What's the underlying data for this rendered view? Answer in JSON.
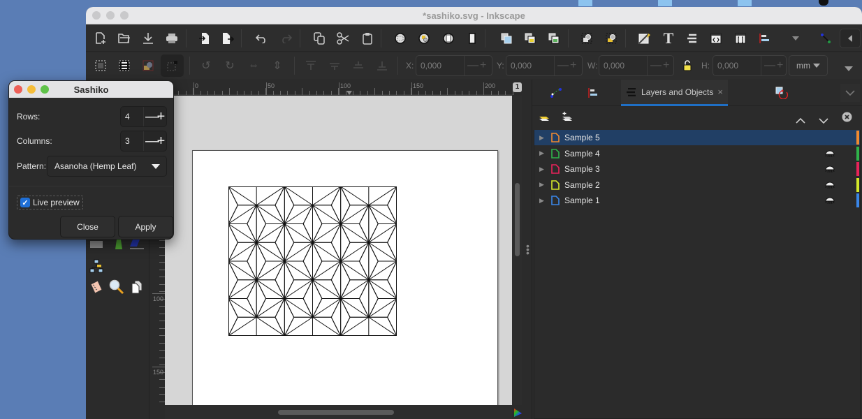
{
  "window": {
    "title": "*sashiko.svg - Inkscape"
  },
  "toolbar1": {
    "buttons": [
      {
        "name": "new-document",
        "icon": "new-document-icon"
      },
      {
        "name": "open",
        "icon": "folder-open-icon"
      },
      {
        "name": "save",
        "icon": "download-icon"
      },
      {
        "name": "print",
        "icon": "printer-icon"
      },
      {
        "name": "import",
        "icon": "import-icon"
      },
      {
        "name": "export",
        "icon": "export-icon"
      },
      {
        "name": "undo",
        "icon": "undo-icon"
      },
      {
        "name": "redo",
        "icon": "redo-icon"
      },
      {
        "name": "copy",
        "icon": "copy-icon"
      },
      {
        "name": "cut",
        "icon": "scissors-icon"
      },
      {
        "name": "paste",
        "icon": "clipboard-icon"
      },
      {
        "name": "zoom-selection",
        "icon": "zoom-selection-icon"
      },
      {
        "name": "zoom-drawing",
        "icon": "zoom-drawing-icon"
      },
      {
        "name": "zoom-page",
        "icon": "zoom-page-icon"
      },
      {
        "name": "zoom-page-width",
        "icon": "zoom-page-width-icon"
      },
      {
        "name": "duplicate",
        "icon": "duplicate-icon"
      },
      {
        "name": "clone",
        "icon": "clone-icon"
      },
      {
        "name": "unlink-clone",
        "icon": "unlink-clone-icon"
      },
      {
        "name": "group",
        "icon": "group-icon"
      },
      {
        "name": "ungroup",
        "icon": "ungroup-icon"
      },
      {
        "name": "fill-stroke",
        "icon": "fill-stroke-icon"
      },
      {
        "name": "text-font",
        "icon": "text-icon"
      },
      {
        "name": "layers",
        "icon": "layers-icon"
      },
      {
        "name": "xml-editor",
        "icon": "xml-editor-icon"
      },
      {
        "name": "selectors-css",
        "icon": "css-icon"
      },
      {
        "name": "align-distribute",
        "icon": "align-icon"
      },
      {
        "name": "more",
        "icon": "dropdown-icon"
      },
      {
        "name": "snap",
        "icon": "snap-icon"
      },
      {
        "name": "collapse-snap",
        "icon": "chevron-left-icon"
      }
    ]
  },
  "toolbar2": {
    "x_label": "X:",
    "x_value": "0,000",
    "y_label": "Y:",
    "y_value": "0,000",
    "w_label": "W:",
    "w_value": "0,000",
    "h_label": "H:",
    "h_value": "0,000",
    "unit": "mm"
  },
  "ruler": {
    "top_labels": [
      "0",
      "50",
      "100",
      "150",
      "200"
    ],
    "left_labels": [
      "100",
      "150"
    ],
    "page_number": "1"
  },
  "dock": {
    "tabs": [
      {
        "icon": "node-editor-icon",
        "label": ""
      },
      {
        "icon": "align-icon",
        "label": ""
      },
      {
        "icon": "layers-icon",
        "label": "Layers and Objects",
        "active": true
      },
      {
        "icon": "transform-icon",
        "label": ""
      }
    ],
    "close_glyph": "×",
    "layers": [
      {
        "name": "Sample 5",
        "color": "#f08a30",
        "selected": true,
        "visible_icon": false
      },
      {
        "name": "Sample 4",
        "color": "#2fb34a",
        "selected": false,
        "visible_icon": true
      },
      {
        "name": "Sample 3",
        "color": "#e8235a",
        "selected": false,
        "visible_icon": true
      },
      {
        "name": "Sample 2",
        "color": "#d3e82a",
        "selected": false,
        "visible_icon": true
      },
      {
        "name": "Sample 1",
        "color": "#3a86e8",
        "selected": false,
        "visible_icon": true
      }
    ]
  },
  "dialog": {
    "title": "Sashiko",
    "rows_label": "Rows:",
    "rows_value": "4",
    "columns_label": "Columns:",
    "columns_value": "3",
    "pattern_label": "Pattern:",
    "pattern_value": "Asanoha (Hemp Leaf)",
    "live_preview_label": "Live preview",
    "live_preview_checked": true,
    "close_label": "Close",
    "apply_label": "Apply",
    "minus_glyph": "—",
    "plus_glyph": "+"
  },
  "colors": {
    "accent": "#1f6fc5",
    "selected_row": "#213f65",
    "checkbox": "#1f6fd6"
  }
}
